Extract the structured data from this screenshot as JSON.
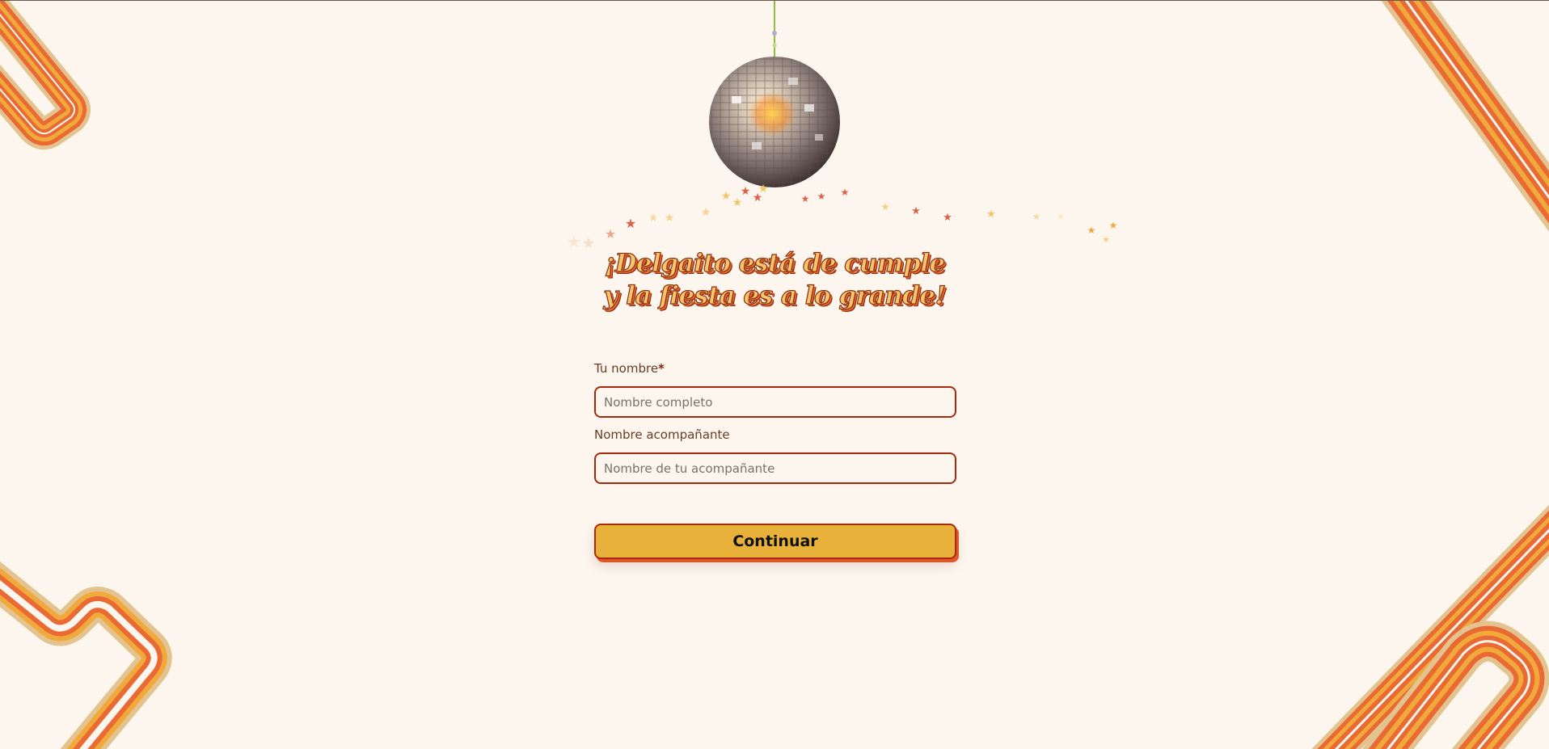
{
  "header": {
    "title": "¡Delgaito está de cumple y la fiesta es a lo grande!"
  },
  "form": {
    "name": {
      "label": "Tu nombre",
      "required_mark": "*",
      "placeholder": "Nombre completo",
      "value": ""
    },
    "companion": {
      "label": "Nombre acompañante",
      "placeholder": "Nombre de tu acompañante",
      "value": ""
    },
    "submit_label": "Continuar"
  },
  "colors": {
    "background": "#fdf6ef",
    "stripe_orange": "#ea6a33",
    "stripe_amber": "#f0a93a",
    "stripe_tan": "#e3c38f",
    "button": "#e8b23a",
    "border": "#a62a0c",
    "label": "#6b3a22"
  },
  "icons": {
    "disco_ball": "disco-ball-icon",
    "stars": "star-icon"
  }
}
